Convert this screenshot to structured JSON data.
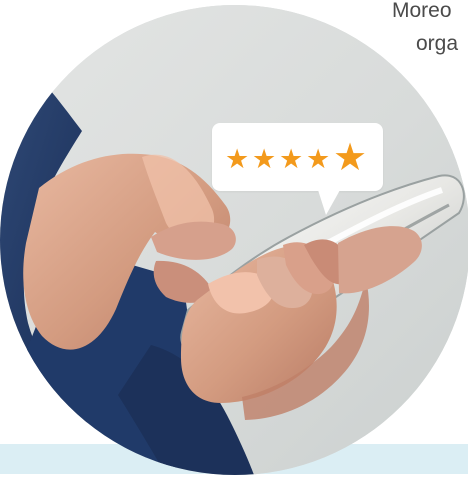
{
  "text": {
    "line_one": "Moreo",
    "line_two": "orga"
  },
  "rating": {
    "stars": [
      {
        "icon": "star-icon",
        "glyph": "★",
        "size": "small"
      },
      {
        "icon": "star-icon",
        "glyph": "★",
        "size": "small"
      },
      {
        "icon": "star-icon",
        "glyph": "★",
        "size": "small"
      },
      {
        "icon": "star-icon",
        "glyph": "★",
        "size": "small"
      },
      {
        "icon": "star-icon",
        "glyph": "★",
        "size": "large"
      }
    ],
    "value": 5,
    "max": 5,
    "color": "#f39a1c"
  },
  "colors": {
    "band": "#dbeef4",
    "text": "#4b4b4b",
    "sleeve": "#20365f",
    "skin": "#d5a18a",
    "phone": "#f4f4f1"
  }
}
